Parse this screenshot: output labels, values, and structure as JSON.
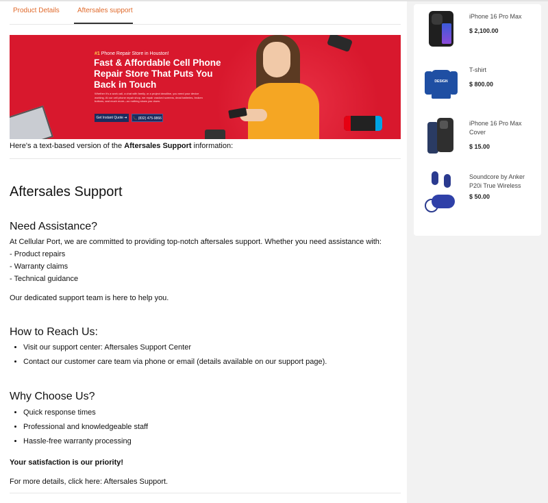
{
  "tabs": [
    {
      "label": "Product Details"
    },
    {
      "label": "Aftersales support"
    }
  ],
  "banner": {
    "tag_num": "#1",
    "tag_text": " Phone Repair Store in Houston!",
    "headline": "Fast & Affordable Cell Phone Repair Store That Puts You Back in Touch",
    "body": "Whether it's a work call, a chat with family, or a project deadline, you need your device working. At our cell phone repair shop, we repair cracked screens, dead batteries, broken buttons, and much more—so nothing slows you down.",
    "btn_quote": "Get Instant Quote ➜",
    "btn_phone": "📞 (832) 475-9866"
  },
  "intro": {
    "pre": "Here's a text-based version of the ",
    "bold": "Aftersales Support",
    "post": " information:"
  },
  "title": "Aftersales Support",
  "need_assistance": {
    "heading": "Need Assistance?",
    "lead": "At Cellular Port, we are committed to providing top-notch aftersales support. Whether you need assistance with:",
    "items": [
      "- Product repairs",
      "- Warranty claims",
      "- Technical guidance"
    ],
    "closing": "Our dedicated support team is here to help you."
  },
  "reach": {
    "heading": "How to Reach Us:",
    "items": [
      "Visit our support center: Aftersales Support Center",
      "Contact our customer care team via phone or email (details available on our support page)."
    ]
  },
  "why": {
    "heading": "Why Choose Us?",
    "items": [
      "Quick response times",
      "Professional and knowledgeable staff",
      "Hassle-free warranty processing"
    ]
  },
  "satisfaction": "Your satisfaction is our priority!",
  "more": "For more details, click here: Aftersales Support.",
  "sidebar": {
    "products": [
      {
        "name": "iPhone 16 Pro Max",
        "price": "$ 2,100.00",
        "icon": "iphone-icon"
      },
      {
        "name": "T-shirt",
        "price": "$ 800.00",
        "icon": "sweatshirt-icon"
      },
      {
        "name": "iPhone 16 Pro Max Cover",
        "price": "$ 15.00",
        "icon": "phone-case-icon"
      },
      {
        "name": "Soundcore by Anker P20i True Wireless",
        "price": "$ 50.00",
        "icon": "earbuds-icon"
      }
    ]
  },
  "colors": {
    "accent": "#e0692a",
    "banner_red": "#d8182d",
    "button_navy": "#1c2c5e"
  }
}
